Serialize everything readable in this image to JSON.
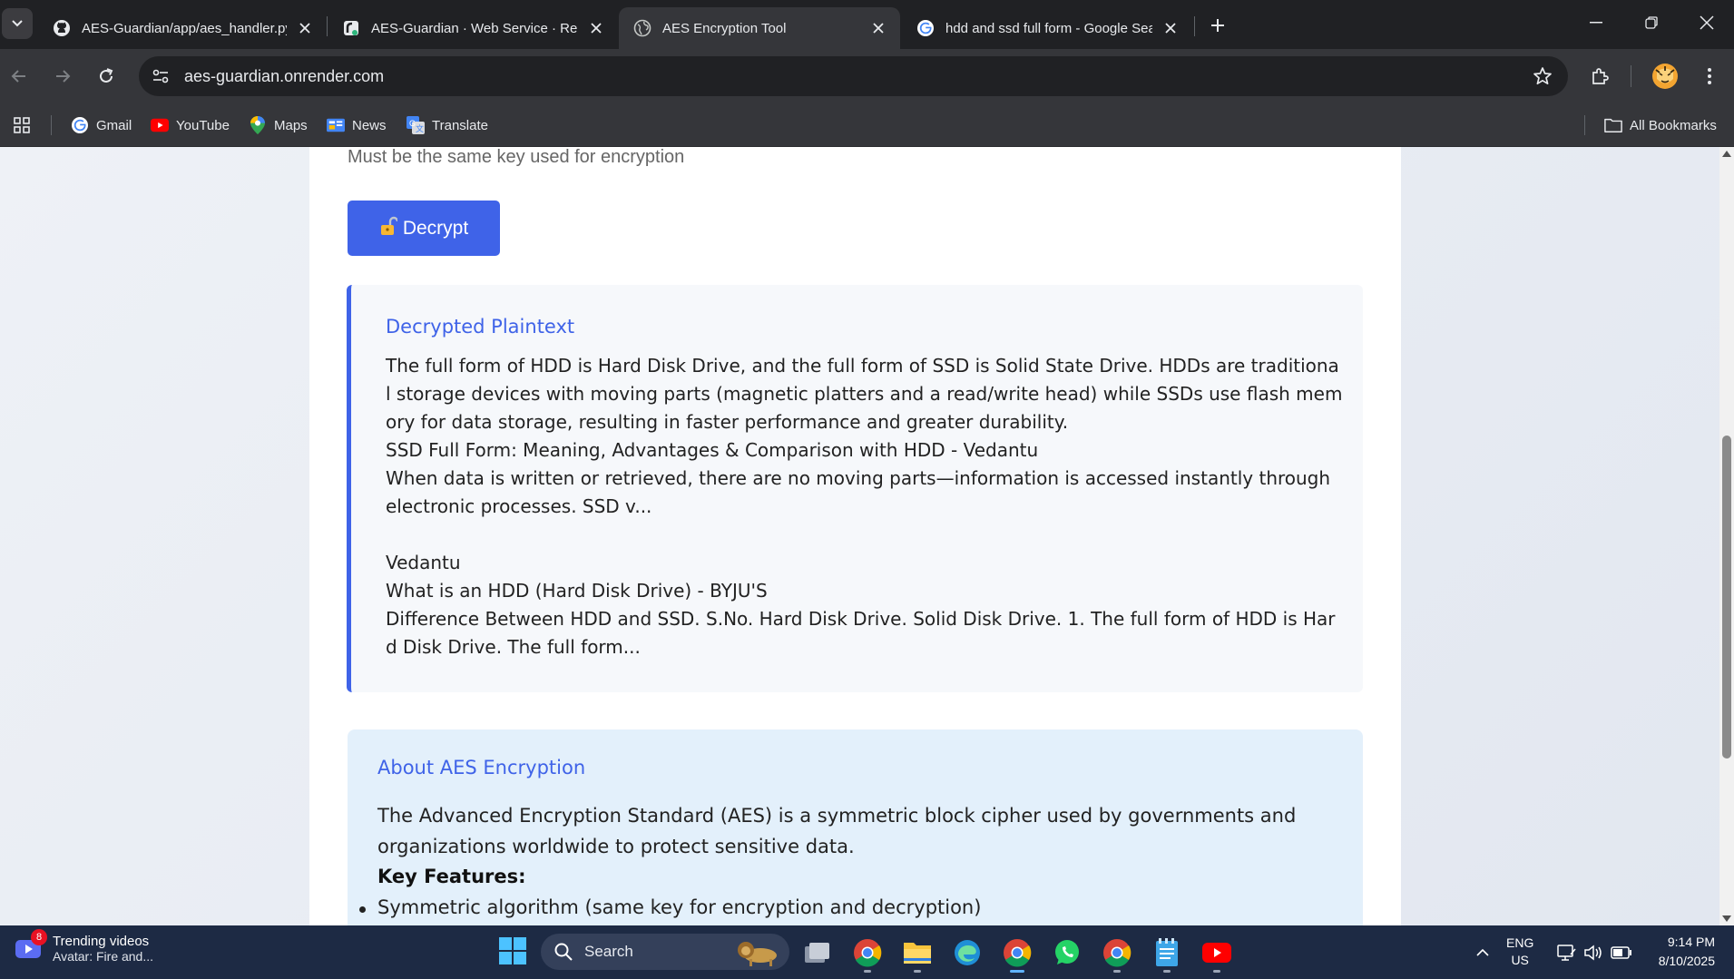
{
  "browser": {
    "tabs": [
      {
        "title": "AES-Guardian/app/aes_handler.py",
        "icon": "github-icon"
      },
      {
        "title": "AES-Guardian · Web Service · Ren",
        "icon": "render-icon"
      },
      {
        "title": "AES Encryption Tool",
        "icon": "globe-icon",
        "active": true
      },
      {
        "title": "hdd and ssd full form - Google Sea",
        "icon": "google-icon"
      }
    ],
    "url": "aes-guardian.onrender.com",
    "bookmarks": [
      {
        "label": "Gmail",
        "icon": "google-icon"
      },
      {
        "label": "YouTube",
        "icon": "youtube-icon"
      },
      {
        "label": "Maps",
        "icon": "maps-icon"
      },
      {
        "label": "News",
        "icon": "news-icon"
      },
      {
        "label": "Translate",
        "icon": "translate-icon"
      }
    ],
    "all_bookmarks": "All Bookmarks"
  },
  "page": {
    "key_hint": "Must be the same key used for encryption",
    "decrypt_button": "Decrypt",
    "result": {
      "heading": "Decrypted Plaintext",
      "text": "The full form of HDD is Hard Disk Drive, and the full form of SSD is Solid State Drive. HDDs are traditional storage devices with moving parts (magnetic platters and a read/write head) while SSDs use flash memory for data storage, resulting in faster performance and greater durability.\nSSD Full Form: Meaning, Advantages & Comparison with HDD - Vedantu\nWhen data is written or retrieved, there are no moving parts—information is accessed instantly through electronic processes. SSD v...\n\nVedantu\nWhat is an HDD (Hard Disk Drive) - BYJU'S\nDifference Between HDD and SSD. S.No. Hard Disk Drive. Solid Disk Drive. 1. The full form of HDD is Hard Disk Drive. The full form..."
    },
    "about": {
      "heading": "About AES Encryption",
      "description": "The Advanced Encryption Standard (AES) is a symmetric block cipher used by governments and organizations worldwide to protect sensitive data.",
      "key_features_label": "Key Features:",
      "features": [
        "Symmetric algorithm (same key for encryption and decryption)"
      ]
    }
  },
  "taskbar": {
    "widget_title": "Trending videos",
    "widget_subtitle": "Avatar: Fire and...",
    "widget_badge": "8",
    "search_placeholder": "Search",
    "lang_top": "ENG",
    "lang_bottom": "US",
    "time": "9:14 PM",
    "date": "8/10/2025"
  },
  "colors": {
    "accent": "#3f63e8",
    "chrome_dark": "#202124",
    "chrome_toolbar": "#35363a",
    "taskbar": "#1d2a44"
  }
}
